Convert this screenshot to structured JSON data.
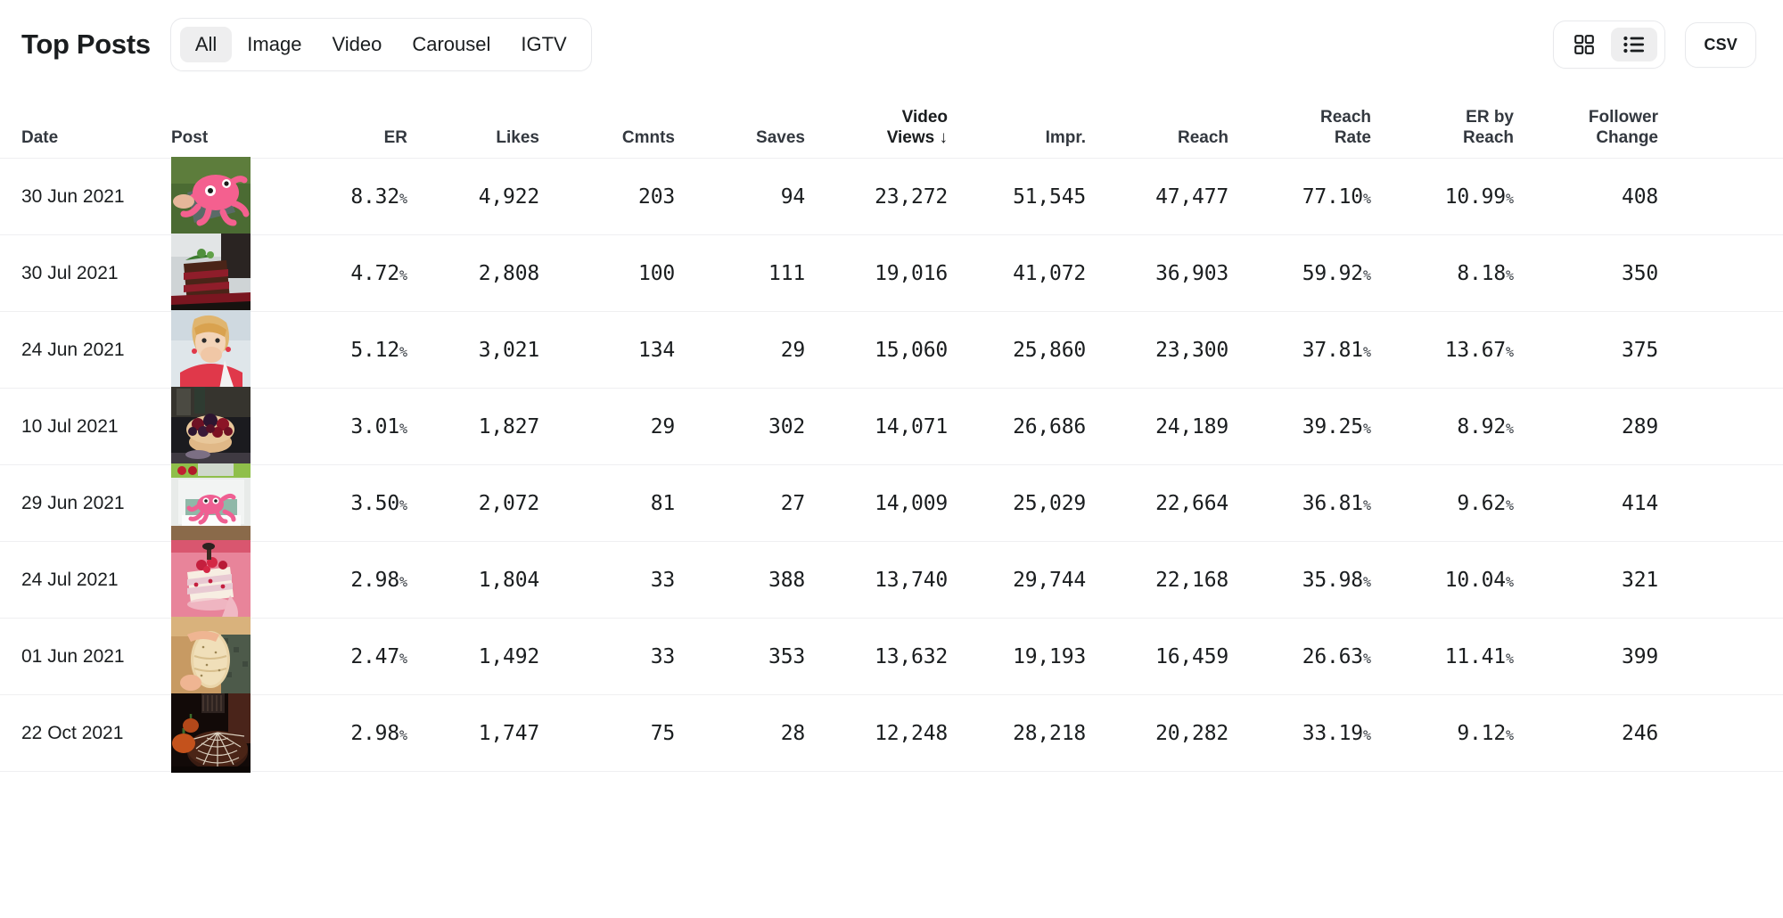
{
  "header": {
    "title": "Top Posts",
    "tabs": [
      {
        "label": "All",
        "active": true
      },
      {
        "label": "Image",
        "active": false
      },
      {
        "label": "Video",
        "active": false
      },
      {
        "label": "Carousel",
        "active": false
      },
      {
        "label": "IGTV",
        "active": false
      }
    ],
    "view_toggle": [
      {
        "name": "grid-view",
        "icon": "grid-icon",
        "active": false
      },
      {
        "name": "list-view",
        "icon": "list-icon",
        "active": true
      }
    ],
    "export_label": "CSV"
  },
  "table": {
    "columns": [
      {
        "key": "date",
        "label": "Date",
        "sorted": false
      },
      {
        "key": "post",
        "label": "Post",
        "sorted": false
      },
      {
        "key": "er",
        "label": "ER",
        "sorted": false
      },
      {
        "key": "likes",
        "label": "Likes",
        "sorted": false
      },
      {
        "key": "cmnts",
        "label": "Cmnts",
        "sorted": false
      },
      {
        "key": "saves",
        "label": "Saves",
        "sorted": false
      },
      {
        "key": "views",
        "label": "Video\nViews ↓",
        "sorted": true
      },
      {
        "key": "impr",
        "label": "Impr.",
        "sorted": false
      },
      {
        "key": "reach",
        "label": "Reach",
        "sorted": false
      },
      {
        "key": "rrate",
        "label": "Reach\nRate",
        "sorted": false
      },
      {
        "key": "erbyr",
        "label": "ER by\nReach",
        "sorted": false
      },
      {
        "key": "follow",
        "label": "Follower\nChange",
        "sorted": false
      }
    ],
    "sort": {
      "column": "Video Views",
      "direction": "desc",
      "glyph": "↓"
    },
    "percent_suffix": "%",
    "rows": [
      {
        "date": "30 Jun 2021",
        "thumb": "pink-octopus-toy-on-grass",
        "er": "8.32",
        "likes": "4,922",
        "cmnts": "203",
        "saves": "94",
        "views": "23,272",
        "impr": "51,545",
        "reach": "47,477",
        "reach_rate": "77.10",
        "er_by_reach": "10.99",
        "follower_change": "408"
      },
      {
        "date": "30 Jul 2021",
        "thumb": "chocolate-layer-cake-slice",
        "er": "4.72",
        "likes": "2,808",
        "cmnts": "100",
        "saves": "111",
        "views": "19,016",
        "impr": "41,072",
        "reach": "36,903",
        "reach_rate": "59.92",
        "er_by_reach": "8.18",
        "follower_change": "350"
      },
      {
        "date": "24 Jun 2021",
        "thumb": "woman-covering-mouth-red-top",
        "er": "5.12",
        "likes": "3,021",
        "cmnts": "134",
        "saves": "29",
        "views": "15,060",
        "impr": "25,860",
        "reach": "23,300",
        "reach_rate": "37.81",
        "er_by_reach": "13.67",
        "follower_change": "375"
      },
      {
        "date": "10 Jul 2021",
        "thumb": "berry-tart-pastry",
        "er": "3.01",
        "likes": "1,827",
        "cmnts": "29",
        "saves": "302",
        "views": "14,071",
        "impr": "26,686",
        "reach": "24,189",
        "reach_rate": "39.25",
        "er_by_reach": "8.92",
        "follower_change": "289"
      },
      {
        "date": "29 Jun 2021",
        "thumb": "pink-octopus-toy-in-fridge",
        "er": "3.50",
        "likes": "2,072",
        "cmnts": "81",
        "saves": "27",
        "views": "14,009",
        "impr": "25,029",
        "reach": "22,664",
        "reach_rate": "36.81",
        "er_by_reach": "9.62",
        "follower_change": "414"
      },
      {
        "date": "24 Jul 2021",
        "thumb": "raspberry-cream-cake-slice",
        "er": "2.98",
        "likes": "1,804",
        "cmnts": "33",
        "saves": "388",
        "views": "13,740",
        "impr": "29,744",
        "reach": "22,168",
        "reach_rate": "35.98",
        "er_by_reach": "10.04",
        "follower_change": "321"
      },
      {
        "date": "01 Jun 2021",
        "thumb": "bread-loaf-in-hands",
        "er": "2.47",
        "likes": "1,492",
        "cmnts": "33",
        "saves": "353",
        "views": "13,632",
        "impr": "19,193",
        "reach": "16,459",
        "reach_rate": "26.63",
        "er_by_reach": "11.41",
        "follower_change": "399"
      },
      {
        "date": "22 Oct 2021",
        "thumb": "halloween-spiderweb-cake-pumpkins",
        "er": "2.98",
        "likes": "1,747",
        "cmnts": "75",
        "saves": "28",
        "views": "12,248",
        "impr": "28,218",
        "reach": "20,282",
        "reach_rate": "33.19",
        "er_by_reach": "9.12",
        "follower_change": "246"
      }
    ]
  },
  "colors": {
    "text_primary": "#1a1d1f",
    "text_secondary": "#33383f",
    "divider": "#efeff1",
    "pill_active": "#eeeeef",
    "border": "#e8e9ec",
    "background": "#ffffff"
  }
}
